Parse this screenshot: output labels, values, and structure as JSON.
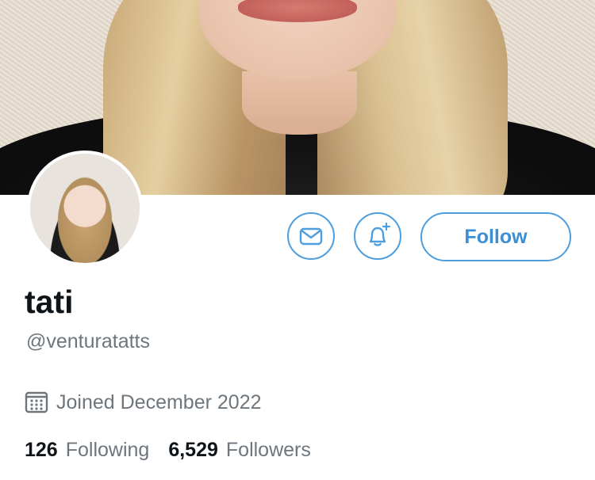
{
  "profile": {
    "display_name": "tati",
    "handle": "@venturatatts",
    "joined": "Joined December 2022",
    "following_count": "126",
    "following_label": "Following",
    "followers_count": "6,529",
    "followers_label": "Followers"
  },
  "actions": {
    "follow_label": "Follow",
    "message_icon": "mail-icon",
    "notify_icon": "bell-plus-icon"
  },
  "icons": {
    "joined": "calendar-icon"
  },
  "colors": {
    "accent": "#4d9ede",
    "text_primary": "#0f1419",
    "text_secondary": "#6e767d"
  }
}
